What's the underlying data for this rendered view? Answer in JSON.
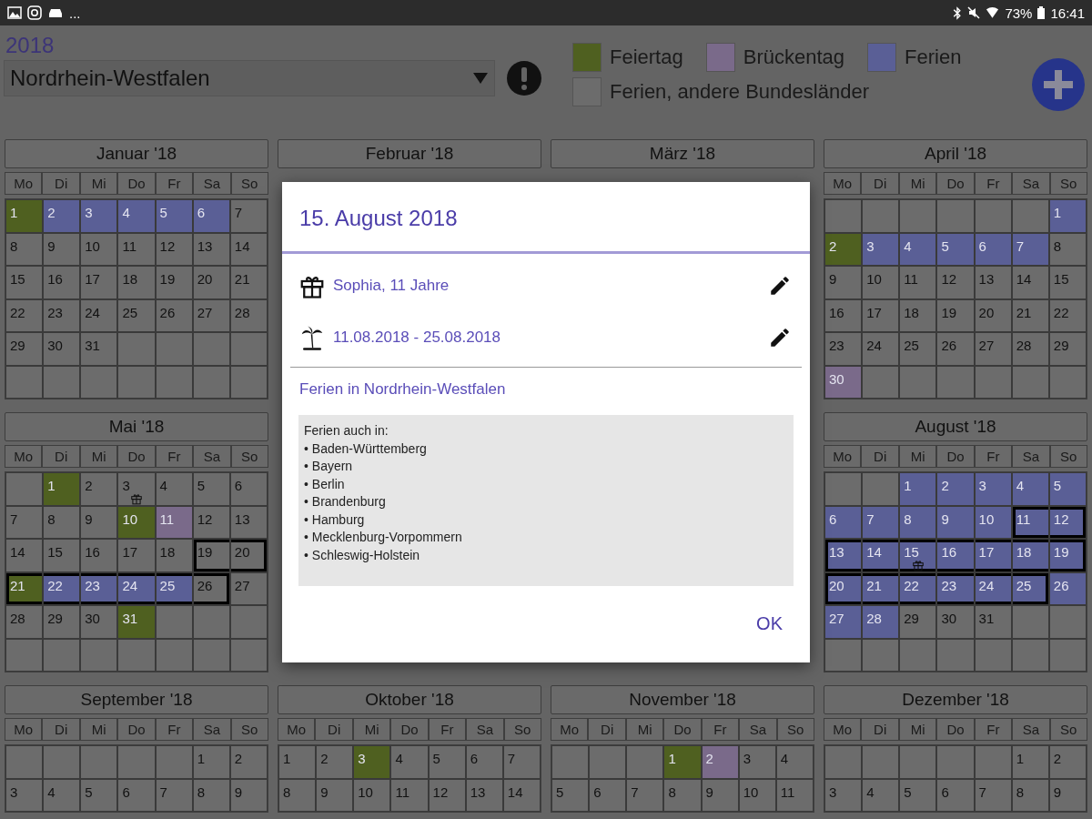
{
  "status_bar": {
    "left_text": "...",
    "battery": "73%",
    "time": "16:41"
  },
  "header": {
    "year": "2018",
    "region": "Nordrhein-Westfalen",
    "legend": [
      {
        "label": "Feiertag",
        "color": "#4f6020"
      },
      {
        "label": "Brückentag",
        "color": "#7a6a8a"
      },
      {
        "label": "Ferien",
        "color": "#5a5f96"
      },
      {
        "label": "Ferien, andere Bundesländer",
        "color": "#6c6c6c"
      }
    ]
  },
  "month_rows": [
    [
      {
        "title": "Januar '18",
        "weekdays": [
          "Mo",
          "Di",
          "Mi",
          "Do",
          "Fr",
          "Sa",
          "So"
        ],
        "weeks": [
          [
            {
              "day": "1",
              "kind": "holiday"
            },
            {
              "day": "2",
              "kind": "vacation"
            },
            {
              "day": "3",
              "kind": "vacation"
            },
            {
              "day": "4",
              "kind": "vacation"
            },
            {
              "day": "5",
              "kind": "vacation"
            },
            {
              "day": "6",
              "kind": "vacation"
            },
            {
              "day": "7",
              "kind": "normal"
            }
          ],
          [
            {
              "day": "8",
              "kind": "normal"
            },
            {
              "day": "9",
              "kind": "normal"
            },
            {
              "day": "10",
              "kind": "normal"
            },
            {
              "day": "11",
              "kind": "normal"
            },
            {
              "day": "12",
              "kind": "normal"
            },
            {
              "day": "13",
              "kind": "normal"
            },
            {
              "day": "14",
              "kind": "normal"
            }
          ],
          [
            {
              "day": "15",
              "kind": "normal"
            },
            {
              "day": "16",
              "kind": "normal"
            },
            {
              "day": "17",
              "kind": "normal"
            },
            {
              "day": "18",
              "kind": "normal"
            },
            {
              "day": "19",
              "kind": "normal"
            },
            {
              "day": "20",
              "kind": "normal"
            },
            {
              "day": "21",
              "kind": "normal"
            }
          ],
          [
            {
              "day": "22",
              "kind": "normal"
            },
            {
              "day": "23",
              "kind": "normal"
            },
            {
              "day": "24",
              "kind": "normal"
            },
            {
              "day": "25",
              "kind": "normal"
            },
            {
              "day": "26",
              "kind": "normal"
            },
            {
              "day": "27",
              "kind": "normal"
            },
            {
              "day": "28",
              "kind": "normal"
            }
          ],
          [
            {
              "day": "29",
              "kind": "normal"
            },
            {
              "day": "30",
              "kind": "normal"
            },
            {
              "day": "31",
              "kind": "normal"
            },
            {
              "kind": "blank"
            },
            {
              "kind": "blank"
            },
            {
              "kind": "blank"
            },
            {
              "kind": "blank"
            }
          ],
          [
            {
              "kind": "blank"
            },
            {
              "kind": "blank"
            },
            {
              "kind": "blank"
            },
            {
              "kind": "blank"
            },
            {
              "kind": "blank"
            },
            {
              "kind": "blank"
            },
            {
              "kind": "blank"
            }
          ]
        ]
      },
      {
        "title": "Februar '18"
      },
      {
        "title": "März '18"
      },
      {
        "title": "April '18",
        "weekdays": [
          "Mo",
          "Di",
          "Mi",
          "Do",
          "Fr",
          "Sa",
          "So"
        ],
        "weeks": [
          [
            {
              "kind": "blank"
            },
            {
              "kind": "blank"
            },
            {
              "kind": "blank"
            },
            {
              "kind": "blank"
            },
            {
              "kind": "blank"
            },
            {
              "kind": "blank"
            },
            {
              "day": "1",
              "kind": "vacation"
            }
          ],
          [
            {
              "day": "2",
              "kind": "holiday"
            },
            {
              "day": "3",
              "kind": "vacation"
            },
            {
              "day": "4",
              "kind": "vacation"
            },
            {
              "day": "5",
              "kind": "vacation"
            },
            {
              "day": "6",
              "kind": "vacation"
            },
            {
              "day": "7",
              "kind": "vacation"
            },
            {
              "day": "8",
              "kind": "normal"
            }
          ],
          [
            {
              "day": "9",
              "kind": "normal"
            },
            {
              "day": "10",
              "kind": "normal"
            },
            {
              "day": "11",
              "kind": "normal"
            },
            {
              "day": "12",
              "kind": "normal"
            },
            {
              "day": "13",
              "kind": "normal"
            },
            {
              "day": "14",
              "kind": "normal"
            },
            {
              "day": "15",
              "kind": "normal"
            }
          ],
          [
            {
              "day": "16",
              "kind": "normal"
            },
            {
              "day": "17",
              "kind": "normal"
            },
            {
              "day": "18",
              "kind": "normal"
            },
            {
              "day": "19",
              "kind": "normal"
            },
            {
              "day": "20",
              "kind": "normal"
            },
            {
              "day": "21",
              "kind": "normal"
            },
            {
              "day": "22",
              "kind": "normal"
            }
          ],
          [
            {
              "day": "23",
              "kind": "normal"
            },
            {
              "day": "24",
              "kind": "normal"
            },
            {
              "day": "25",
              "kind": "normal"
            },
            {
              "day": "26",
              "kind": "normal"
            },
            {
              "day": "27",
              "kind": "normal"
            },
            {
              "day": "28",
              "kind": "normal"
            },
            {
              "day": "29",
              "kind": "normal"
            }
          ],
          [
            {
              "day": "30",
              "kind": "bridge"
            },
            {
              "kind": "blank"
            },
            {
              "kind": "blank"
            },
            {
              "kind": "blank"
            },
            {
              "kind": "blank"
            },
            {
              "kind": "blank"
            },
            {
              "kind": "blank"
            }
          ]
        ]
      }
    ],
    [
      {
        "title": "Mai '18",
        "weekdays": [
          "Mo",
          "Di",
          "Mi",
          "Do",
          "Fr",
          "Sa",
          "So"
        ],
        "weeks": [
          [
            {
              "kind": "blank"
            },
            {
              "day": "1",
              "kind": "holiday"
            },
            {
              "day": "2",
              "kind": "normal"
            },
            {
              "day": "3",
              "kind": "normal",
              "birthday": true
            },
            {
              "day": "4",
              "kind": "normal"
            },
            {
              "day": "5",
              "kind": "normal"
            },
            {
              "day": "6",
              "kind": "normal"
            }
          ],
          [
            {
              "day": "7",
              "kind": "normal"
            },
            {
              "day": "8",
              "kind": "normal"
            },
            {
              "day": "9",
              "kind": "normal"
            },
            {
              "day": "10",
              "kind": "holiday"
            },
            {
              "day": "11",
              "kind": "bridge"
            },
            {
              "day": "12",
              "kind": "normal"
            },
            {
              "day": "13",
              "kind": "normal"
            }
          ],
          [
            {
              "day": "14",
              "kind": "normal"
            },
            {
              "day": "15",
              "kind": "normal"
            },
            {
              "day": "16",
              "kind": "normal"
            },
            {
              "day": "17",
              "kind": "normal"
            },
            {
              "day": "18",
              "kind": "normal"
            },
            {
              "day": "19",
              "kind": "normal",
              "framed": true
            },
            {
              "day": "20",
              "kind": "normal",
              "framed": true
            }
          ],
          [
            {
              "day": "21",
              "kind": "holiday",
              "framed": true
            },
            {
              "day": "22",
              "kind": "vacation",
              "framed": true
            },
            {
              "day": "23",
              "kind": "vacation",
              "framed": true
            },
            {
              "day": "24",
              "kind": "vacation",
              "framed": true
            },
            {
              "day": "25",
              "kind": "vacation",
              "framed": true
            },
            {
              "day": "26",
              "kind": "normal",
              "framed": true
            },
            {
              "day": "27",
              "kind": "normal"
            }
          ],
          [
            {
              "day": "28",
              "kind": "normal"
            },
            {
              "day": "29",
              "kind": "normal"
            },
            {
              "day": "30",
              "kind": "normal"
            },
            {
              "day": "31",
              "kind": "holiday"
            },
            {
              "kind": "blank"
            },
            {
              "kind": "blank"
            },
            {
              "kind": "blank"
            }
          ],
          [
            {
              "kind": "blank"
            },
            {
              "kind": "blank"
            },
            {
              "kind": "blank"
            },
            {
              "kind": "blank"
            },
            {
              "kind": "blank"
            },
            {
              "kind": "blank"
            },
            {
              "kind": "blank"
            }
          ]
        ]
      },
      {
        "title": "August '18",
        "weekdays": [
          "Mo",
          "Di",
          "Mi",
          "Do",
          "Fr",
          "Sa",
          "So"
        ],
        "weeks": [
          [
            {
              "kind": "blank"
            },
            {
              "kind": "blank"
            },
            {
              "day": "1",
              "kind": "vacation"
            },
            {
              "day": "2",
              "kind": "vacation"
            },
            {
              "day": "3",
              "kind": "vacation"
            },
            {
              "day": "4",
              "kind": "vacation"
            },
            {
              "day": "5",
              "kind": "vacation"
            }
          ],
          [
            {
              "day": "6",
              "kind": "vacation"
            },
            {
              "day": "7",
              "kind": "vacation"
            },
            {
              "day": "8",
              "kind": "vacation"
            },
            {
              "day": "9",
              "kind": "vacation"
            },
            {
              "day": "10",
              "kind": "vacation"
            },
            {
              "day": "11",
              "kind": "vacation",
              "framed": true
            },
            {
              "day": "12",
              "kind": "vacation",
              "framed": true
            }
          ],
          [
            {
              "day": "13",
              "kind": "vacation",
              "framed": true
            },
            {
              "day": "14",
              "kind": "vacation",
              "framed": true
            },
            {
              "day": "15",
              "kind": "vacation",
              "framed": true,
              "birthday": true
            },
            {
              "day": "16",
              "kind": "vacation",
              "framed": true
            },
            {
              "day": "17",
              "kind": "vacation",
              "framed": true
            },
            {
              "day": "18",
              "kind": "vacation",
              "framed": true
            },
            {
              "day": "19",
              "kind": "vacation",
              "framed": true
            }
          ],
          [
            {
              "day": "20",
              "kind": "vacation",
              "framed": true
            },
            {
              "day": "21",
              "kind": "vacation",
              "framed": true
            },
            {
              "day": "22",
              "kind": "vacation",
              "framed": true
            },
            {
              "day": "23",
              "kind": "vacation",
              "framed": true
            },
            {
              "day": "24",
              "kind": "vacation",
              "framed": true
            },
            {
              "day": "25",
              "kind": "vacation",
              "framed": true
            },
            {
              "day": "26",
              "kind": "vacation"
            }
          ],
          [
            {
              "day": "27",
              "kind": "vacation"
            },
            {
              "day": "28",
              "kind": "vacation"
            },
            {
              "day": "29",
              "kind": "normal"
            },
            {
              "day": "30",
              "kind": "normal"
            },
            {
              "day": "31",
              "kind": "normal"
            },
            {
              "kind": "blank"
            },
            {
              "kind": "blank"
            }
          ],
          [
            {
              "kind": "blank"
            },
            {
              "kind": "blank"
            },
            {
              "kind": "blank"
            },
            {
              "kind": "blank"
            },
            {
              "kind": "blank"
            },
            {
              "kind": "blank"
            },
            {
              "kind": "blank"
            }
          ]
        ]
      }
    ],
    [
      {
        "title": "September '18",
        "weekdays": [
          "Mo",
          "Di",
          "Mi",
          "Do",
          "Fr",
          "Sa",
          "So"
        ],
        "weeks": [
          [
            {
              "kind": "blank"
            },
            {
              "kind": "blank"
            },
            {
              "kind": "blank"
            },
            {
              "kind": "blank"
            },
            {
              "kind": "blank"
            },
            {
              "day": "1",
              "kind": "normal"
            },
            {
              "day": "2",
              "kind": "normal"
            }
          ],
          [
            {
              "day": "3",
              "kind": "normal"
            },
            {
              "day": "4",
              "kind": "normal"
            },
            {
              "day": "5",
              "kind": "normal"
            },
            {
              "day": "6",
              "kind": "normal"
            },
            {
              "day": "7",
              "kind": "normal"
            },
            {
              "day": "8",
              "kind": "normal"
            },
            {
              "day": "9",
              "kind": "normal"
            }
          ]
        ]
      },
      {
        "title": "Oktober '18",
        "weekdays": [
          "Mo",
          "Di",
          "Mi",
          "Do",
          "Fr",
          "Sa",
          "So"
        ],
        "weeks": [
          [
            {
              "day": "1",
              "kind": "normal"
            },
            {
              "day": "2",
              "kind": "normal"
            },
            {
              "day": "3",
              "kind": "holiday"
            },
            {
              "day": "4",
              "kind": "normal"
            },
            {
              "day": "5",
              "kind": "normal"
            },
            {
              "day": "6",
              "kind": "normal"
            },
            {
              "day": "7",
              "kind": "normal"
            }
          ],
          [
            {
              "day": "8",
              "kind": "normal"
            },
            {
              "day": "9",
              "kind": "normal"
            },
            {
              "day": "10",
              "kind": "normal"
            },
            {
              "day": "11",
              "kind": "normal"
            },
            {
              "day": "12",
              "kind": "normal"
            },
            {
              "day": "13",
              "kind": "normal"
            },
            {
              "day": "14",
              "kind": "normal"
            }
          ]
        ]
      },
      {
        "title": "November '18",
        "weekdays": [
          "Mo",
          "Di",
          "Mi",
          "Do",
          "Fr",
          "Sa",
          "So"
        ],
        "weeks": [
          [
            {
              "kind": "blank"
            },
            {
              "kind": "blank"
            },
            {
              "kind": "blank"
            },
            {
              "day": "1",
              "kind": "holiday"
            },
            {
              "day": "2",
              "kind": "bridge"
            },
            {
              "day": "3",
              "kind": "normal"
            },
            {
              "day": "4",
              "kind": "normal"
            }
          ],
          [
            {
              "day": "5",
              "kind": "normal"
            },
            {
              "day": "6",
              "kind": "normal"
            },
            {
              "day": "7",
              "kind": "normal"
            },
            {
              "day": "8",
              "kind": "normal"
            },
            {
              "day": "9",
              "kind": "normal"
            },
            {
              "day": "10",
              "kind": "normal"
            },
            {
              "day": "11",
              "kind": "normal"
            }
          ]
        ]
      },
      {
        "title": "Dezember '18",
        "weekdays": [
          "Mo",
          "Di",
          "Mi",
          "Do",
          "Fr",
          "Sa",
          "So"
        ],
        "weeks": [
          [
            {
              "kind": "blank"
            },
            {
              "kind": "blank"
            },
            {
              "kind": "blank"
            },
            {
              "kind": "blank"
            },
            {
              "kind": "blank"
            },
            {
              "day": "1",
              "kind": "normal"
            },
            {
              "day": "2",
              "kind": "normal"
            }
          ],
          [
            {
              "day": "3",
              "kind": "normal"
            },
            {
              "day": "4",
              "kind": "normal"
            },
            {
              "day": "5",
              "kind": "normal"
            },
            {
              "day": "6",
              "kind": "normal"
            },
            {
              "day": "7",
              "kind": "normal"
            },
            {
              "day": "8",
              "kind": "normal"
            },
            {
              "day": "9",
              "kind": "normal"
            }
          ]
        ]
      }
    ]
  ],
  "dialog": {
    "title": "15. August 2018",
    "entries": [
      {
        "kind": "birthday",
        "text": "Sophia, 11 Jahre"
      },
      {
        "kind": "vacation",
        "text": "11.08.2018 - 25.08.2018"
      }
    ],
    "section": "Ferien in Nordrhein-Westfalen",
    "note_lines": [
      "Ferien auch in:",
      "• Baden-Württemberg",
      "• Bayern",
      "• Berlin",
      "• Brandenburg",
      "• Hamburg",
      "• Mecklenburg-Vorpommern",
      "• Schleswig-Holstein"
    ],
    "ok": "OK"
  }
}
